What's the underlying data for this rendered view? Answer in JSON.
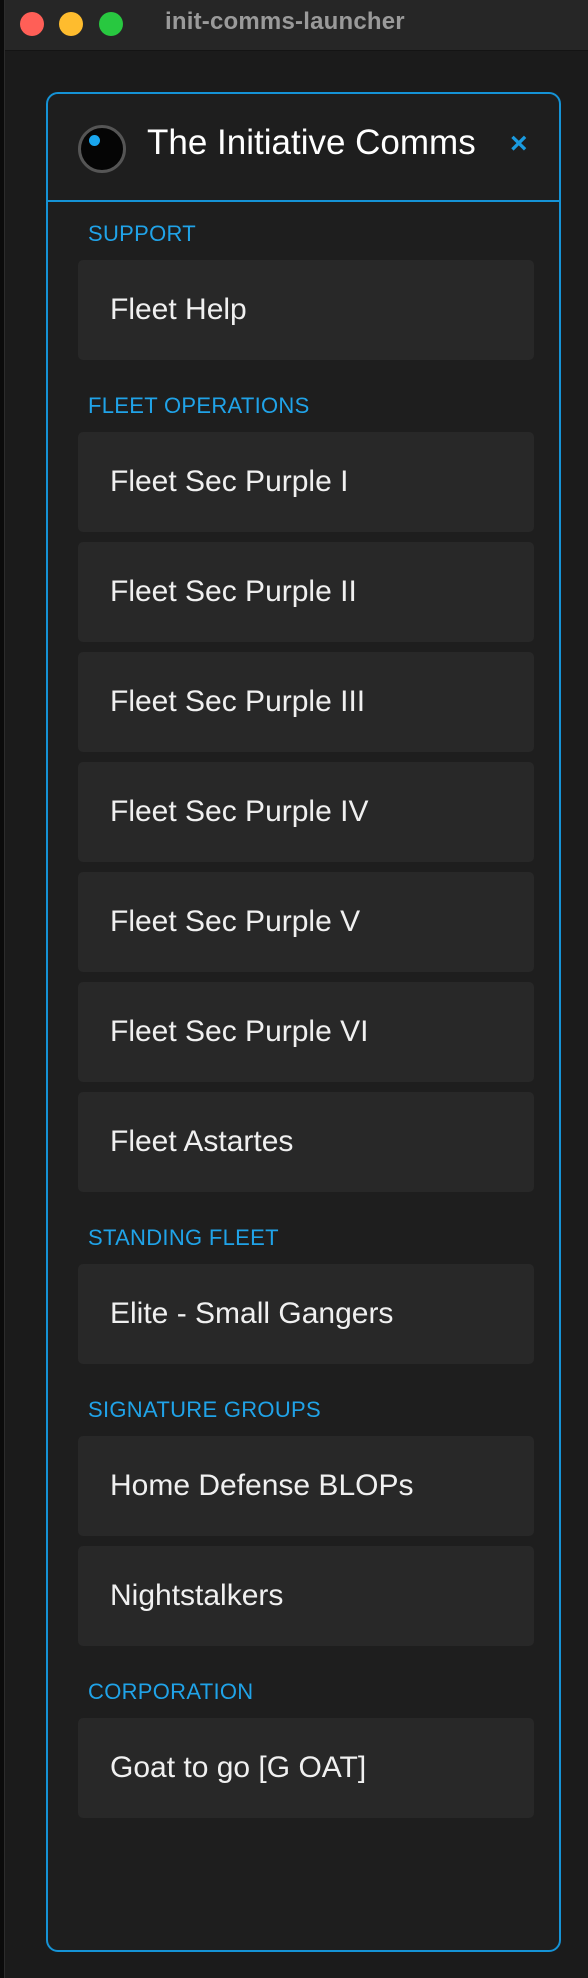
{
  "window": {
    "title": "init-comms-launcher"
  },
  "panel": {
    "title": "The Initiative Comms",
    "close_glyph": "×",
    "sections": [
      {
        "label": "SUPPORT",
        "items": [
          "Fleet Help"
        ]
      },
      {
        "label": "FLEET OPERATIONS",
        "items": [
          "Fleet Sec Purple I",
          "Fleet Sec Purple II",
          "Fleet Sec Purple III",
          "Fleet Sec Purple IV",
          "Fleet Sec Purple V",
          "Fleet Sec Purple VI",
          "Fleet Astartes"
        ]
      },
      {
        "label": "STANDING FLEET",
        "items": [
          "Elite - Small Gangers"
        ]
      },
      {
        "label": "SIGNATURE GROUPS",
        "items": [
          "Home Defense BLOPs",
          "Nightstalkers"
        ]
      },
      {
        "label": "CORPORATION",
        "items": [
          "Goat to go [G OAT]"
        ]
      }
    ]
  },
  "colors": {
    "accent": "#1593d6",
    "section_label": "#20a3e8",
    "item_bg": "#282828",
    "panel_bg": "#1e1e1e"
  },
  "icons": {
    "logo": "initiative-logo-icon",
    "close": "close-icon"
  }
}
